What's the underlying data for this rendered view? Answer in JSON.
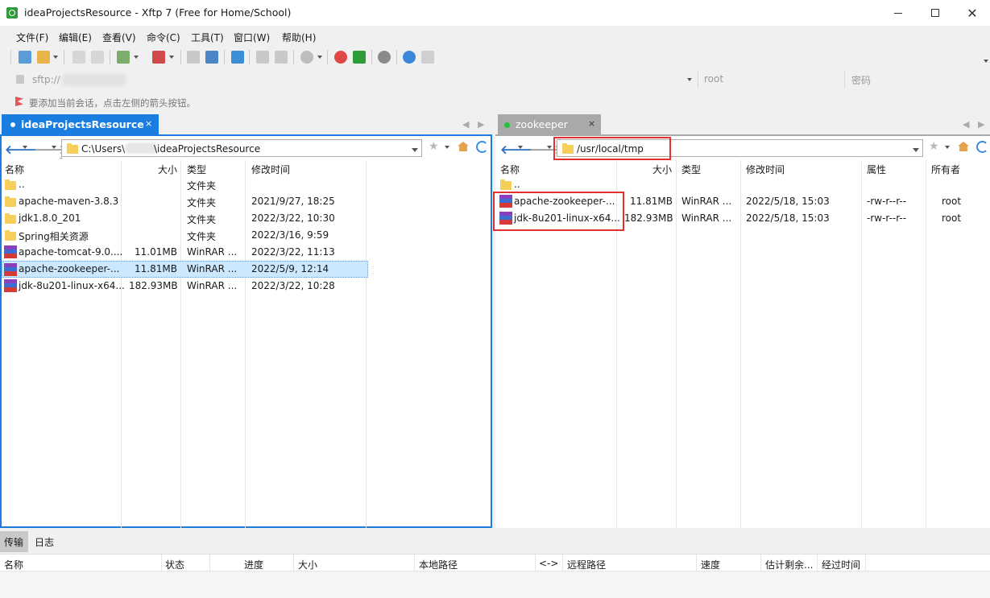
{
  "window": {
    "title": "ideaProjectsResource - Xftp 7 (Free for Home/School)",
    "minimize": "—",
    "maximize": "☐",
    "close": "✕"
  },
  "menu": [
    "文件(F)",
    "编辑(E)",
    "查看(V)",
    "命令(C)",
    "工具(T)",
    "窗口(W)",
    "帮助(H)"
  ],
  "address": {
    "host_prefix": "sftp://",
    "user_placeholder": "root",
    "password_placeholder": "密码"
  },
  "hint": "要添加当前会话，点击左侧的箭头按钮。",
  "tabs": {
    "left": {
      "label": "ideaProjectsResource",
      "close": "×"
    },
    "right": {
      "label": "zookeeper",
      "close": "×"
    },
    "nav_prev": "◀",
    "nav_next": "▶"
  },
  "left_pane": {
    "path_prefix": "C:\\Users\\",
    "path_suffix": "\\ideaProjectsResource",
    "headers": {
      "name": "名称",
      "size": "大小",
      "type": "类型",
      "modified": "修改时间"
    },
    "rows": [
      {
        "name": "..",
        "size": "",
        "type": "文件夹",
        "modified": "",
        "icon": "folder"
      },
      {
        "name": "apache-maven-3.8.3",
        "size": "",
        "type": "文件夹",
        "modified": "2021/9/27, 18:25",
        "icon": "folder"
      },
      {
        "name": "jdk1.8.0_201",
        "size": "",
        "type": "文件夹",
        "modified": "2022/3/22, 10:30",
        "icon": "folder"
      },
      {
        "name": "Spring相关资源",
        "size": "",
        "type": "文件夹",
        "modified": "2022/3/16, 9:59",
        "icon": "folder"
      },
      {
        "name": "apache-tomcat-9.0....",
        "size": "11.01MB",
        "type": "WinRAR ...",
        "modified": "2022/3/22, 11:13",
        "icon": "rar"
      },
      {
        "name": "apache-zookeeper-...",
        "size": "11.81MB",
        "type": "WinRAR ...",
        "modified": "2022/5/9, 12:14",
        "icon": "rar",
        "selected": true
      },
      {
        "name": "jdk-8u201-linux-x64...",
        "size": "182.93MB",
        "type": "WinRAR ...",
        "modified": "2022/3/22, 10:28",
        "icon": "rar"
      }
    ]
  },
  "right_pane": {
    "path": "/usr/local/tmp",
    "headers": {
      "name": "名称",
      "size": "大小",
      "type": "类型",
      "modified": "修改时间",
      "attr": "属性",
      "owner": "所有者"
    },
    "rows": [
      {
        "name": "..",
        "size": "",
        "type": "",
        "modified": "",
        "attr": "",
        "owner": "",
        "icon": "folder"
      },
      {
        "name": "apache-zookeeper-...",
        "size": "11.81MB",
        "type": "WinRAR ...",
        "modified": "2022/5/18, 15:03",
        "attr": "-rw-r--r--",
        "owner": "root",
        "icon": "rar"
      },
      {
        "name": "jdk-8u201-linux-x64...",
        "size": "182.93MB",
        "type": "WinRAR ...",
        "modified": "2022/5/18, 15:03",
        "attr": "-rw-r--r--",
        "owner": "root",
        "icon": "rar"
      }
    ]
  },
  "transfer": {
    "tabs": [
      "传输",
      "日志"
    ],
    "headers": [
      "名称",
      "状态",
      "进度",
      "大小",
      "本地路径",
      "<->",
      "远程路径",
      "速度",
      "估计剩余...",
      "经过时间"
    ]
  },
  "colors": {
    "accent": "#1a7ee0",
    "highlight": "#e03030",
    "selected_row": "#cce8ff"
  }
}
